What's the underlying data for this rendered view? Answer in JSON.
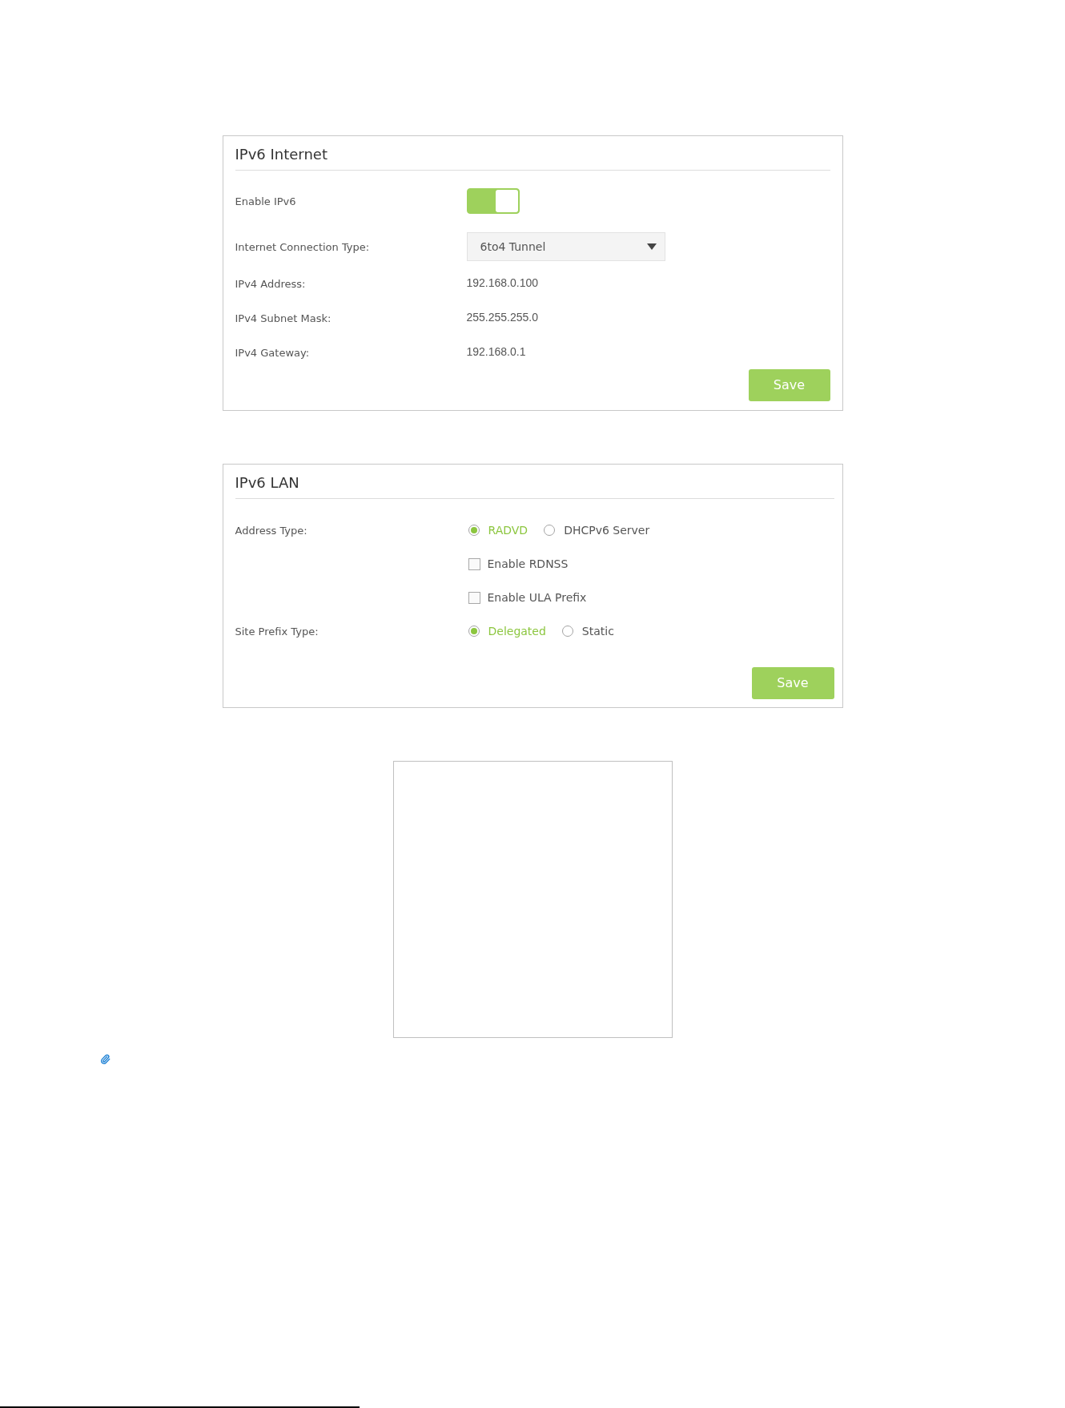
{
  "sections": [
    {
      "kind": "internet",
      "title": "IPv6 Internet",
      "fields": [
        {
          "kind": "toggle",
          "label": "Enable IPv6",
          "on": true
        },
        {
          "kind": "select",
          "label": "Internet Connection Type:",
          "value": "6to4 Tunnel"
        },
        {
          "kind": "text",
          "label": "IPv4 Address:",
          "value": "192.168.0.100"
        },
        {
          "kind": "text",
          "label": "IPv4 Subnet Mask:",
          "value": "255.255.255.0"
        },
        {
          "kind": "text",
          "label": "IPv4 Gateway:",
          "value": "192.168.0.1"
        }
      ],
      "save_button": "Save"
    },
    {
      "kind": "lan",
      "title": "IPv6 LAN",
      "fields": [
        {
          "kind": "radio",
          "label": "Address Type:",
          "options": [
            {
              "label": "RADVD",
              "selected": true
            },
            {
              "label": "DHCPv6 Server",
              "selected": false
            }
          ]
        },
        {
          "kind": "checkbox",
          "text": "Enable RDNSS",
          "checked": false
        },
        {
          "kind": "checkbox",
          "text": "Enable ULA Prefix",
          "checked": false
        },
        {
          "kind": "radio",
          "label": "Site Prefix Type:",
          "options": [
            {
              "label": "Delegated",
              "selected": true
            },
            {
              "label": "Static",
              "selected": false
            }
          ]
        }
      ],
      "save_button": "Save"
    }
  ]
}
